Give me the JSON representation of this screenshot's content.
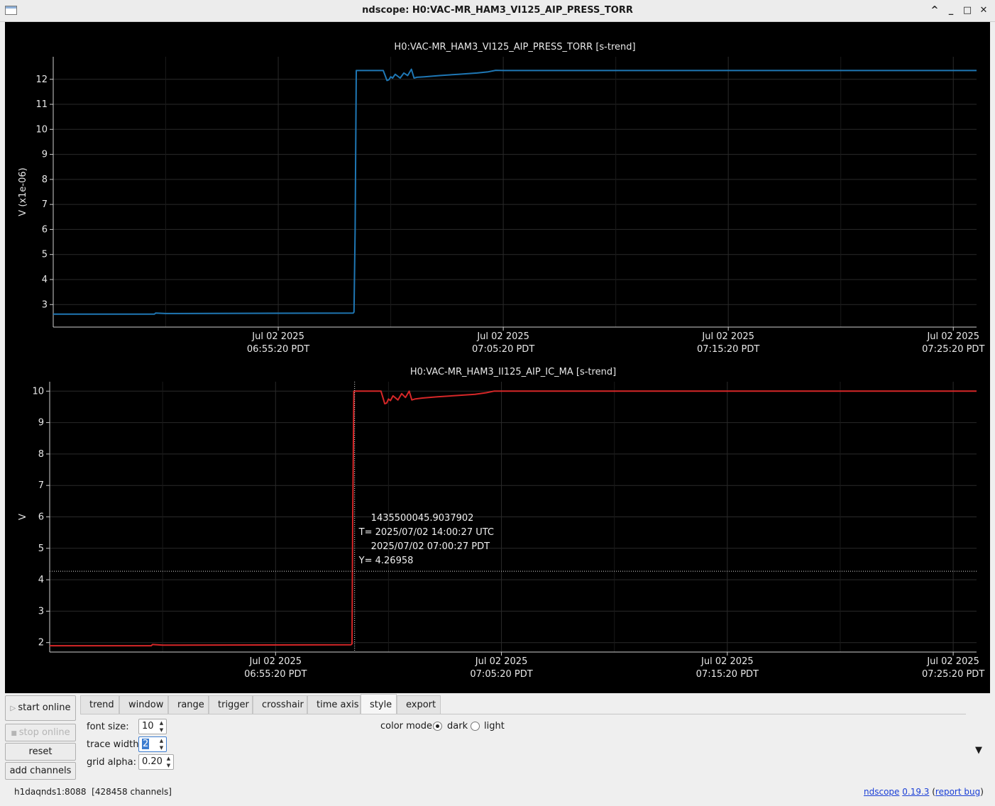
{
  "window": {
    "title": "ndscope: H0:VAC-MR_HAM3_VI125_AIP_PRESS_TORR",
    "controls": [
      "^",
      "_",
      "□",
      "✕"
    ]
  },
  "colors": {
    "plot_bg": "#000000",
    "grid": "#2a2a2a",
    "axis": "#cfcfcf",
    "trace1": "#1f77b4",
    "trace2": "#d62728"
  },
  "chart_data": [
    {
      "type": "line",
      "title": "H0:VAC-MR_HAM3_VI125_AIP_PRESS_TORR [s-trend]",
      "ylabel": "V (x1e-06)",
      "yticks": [
        "3",
        "4",
        "5",
        "6",
        "7",
        "8",
        "9",
        "10",
        "11",
        "12"
      ],
      "ylim": [
        2.1,
        12.9
      ],
      "xlim": [
        0,
        2462
      ],
      "xticks": [
        {
          "x": 600,
          "label1": "Jul 02 2025",
          "label2": "06:55:20 PDT"
        },
        {
          "x": 1200,
          "label1": "Jul 02 2025",
          "label2": "07:05:20 PDT"
        },
        {
          "x": 1800,
          "label1": "Jul 02 2025",
          "label2": "07:15:20 PDT"
        },
        {
          "x": 2400,
          "label1": "Jul 02 2025",
          "label2": "07:25:20 PDT"
        }
      ],
      "grid": true,
      "series": [
        {
          "x": [
            0,
            270,
            273,
            300,
            800,
            802,
            805,
            808,
            810,
            880,
            885,
            890,
            895,
            900,
            905,
            912,
            925,
            935,
            945,
            955,
            962,
            970,
            990,
            1030,
            1080,
            1130,
            1160,
            1180,
            1200,
            1215,
            1250,
            1400,
            2462
          ],
          "y": [
            2.62,
            2.62,
            2.66,
            2.64,
            2.66,
            2.7,
            6.0,
            12.35,
            12.35,
            12.35,
            12.15,
            11.95,
            11.98,
            12.1,
            12.05,
            12.2,
            12.05,
            12.25,
            12.15,
            12.4,
            12.05,
            12.08,
            12.1,
            12.15,
            12.2,
            12.25,
            12.3,
            12.36,
            12.35,
            12.35,
            12.35,
            12.35,
            12.35
          ]
        }
      ]
    },
    {
      "type": "line",
      "title": "H0:VAC-MR_HAM3_II125_AIP_IC_MA [s-trend]",
      "ylabel": "V",
      "yticks": [
        "2",
        "3",
        "4",
        "5",
        "6",
        "7",
        "8",
        "9",
        "10"
      ],
      "ylim": [
        1.7,
        10.3
      ],
      "xlim": [
        0,
        2462
      ],
      "xticks": [
        {
          "x": 600,
          "label1": "Jul 02 2025",
          "label2": "06:55:20 PDT"
        },
        {
          "x": 1200,
          "label1": "Jul 02 2025",
          "label2": "07:05:20 PDT"
        },
        {
          "x": 1800,
          "label1": "Jul 02 2025",
          "label2": "07:15:20 PDT"
        },
        {
          "x": 2400,
          "label1": "Jul 02 2025",
          "label2": "07:25:20 PDT"
        }
      ],
      "grid": true,
      "series": [
        {
          "x": [
            0,
            270,
            273,
            300,
            800,
            803,
            805,
            808,
            810,
            880,
            885,
            890,
            895,
            900,
            905,
            912,
            925,
            935,
            945,
            955,
            962,
            970,
            990,
            1030,
            1080,
            1130,
            1160,
            1180,
            1200,
            1215,
            1250,
            1400,
            2462
          ],
          "y": [
            1.9,
            1.9,
            1.94,
            1.92,
            1.93,
            1.96,
            6.0,
            10.0,
            10.0,
            10.0,
            9.8,
            9.6,
            9.62,
            9.75,
            9.7,
            9.85,
            9.72,
            9.92,
            9.8,
            10.0,
            9.72,
            9.75,
            9.78,
            9.82,
            9.86,
            9.9,
            9.95,
            10.0,
            10.0,
            10.0,
            10.0,
            10.0,
            10.0
          ]
        }
      ],
      "crosshair": {
        "x": 810,
        "y": 4.26958,
        "lines": [
          "1435500045.9037902",
          "T= 2025/07/02 14:00:27 UTC",
          "2025/07/02 07:00:27 PDT",
          "Y= 4.26958"
        ]
      }
    }
  ],
  "sidebar": {
    "start_online": "start online",
    "stop_online": "stop online",
    "reset": "reset",
    "add_channels": "add channels"
  },
  "tabs": [
    "trend",
    "window",
    "range",
    "trigger",
    "crosshair",
    "time axis",
    "style",
    "export"
  ],
  "active_tab": "style",
  "style": {
    "font_size_label": "font size:",
    "font_size": "10",
    "trace_width_label": "trace width:",
    "trace_width": "2",
    "grid_alpha_label": "grid alpha:",
    "grid_alpha": "0.20",
    "color_mode_label": "color mode:",
    "dark_label": "dark",
    "light_label": "light"
  },
  "status": {
    "server": "h1daqnds1:8088",
    "channels": "[428458 channels]",
    "app": "ndscope",
    "version": "0.19.3",
    "report_bug": "report bug"
  }
}
